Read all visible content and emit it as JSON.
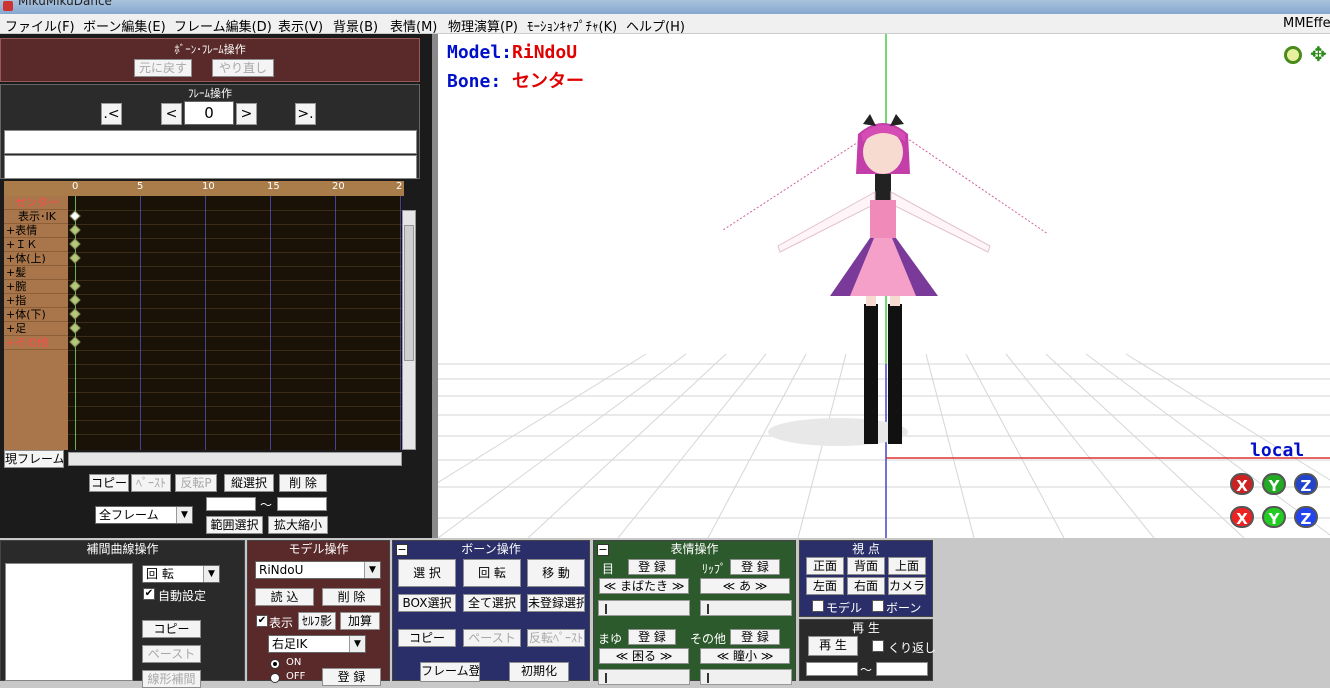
{
  "window": {
    "title": "MikuMikuDance",
    "right_title": "MMEffect"
  },
  "menu": [
    "ファイル(F)",
    "ボーン編集(E)",
    "フレーム編集(D)",
    "表示(V)",
    "背景(B)",
    "表情(M)",
    "物理演算(P)",
    "ﾓｰｼｮﾝｷｬﾌﾟﾁｬ(K)",
    "ヘルプ(H)"
  ],
  "bone_frame_op": {
    "title": "ﾎﾞｰﾝ･ﾌﾚｰﾑ操作",
    "undo": "元に戻す",
    "redo": "やり直し"
  },
  "frame_op": {
    "title": "ﾌﾚｰﾑ操作",
    "prev_key": ".<",
    "prev": "<",
    "frame": "0",
    "next": ">",
    "next_key": ">."
  },
  "timeline": {
    "ticks": [
      "0",
      "5",
      "10",
      "15",
      "20",
      "2"
    ],
    "rows": [
      "センター",
      "表示･IK",
      "+表情",
      "+ＩＫ",
      "+体(上)",
      "+髪",
      "+腕",
      "+指",
      "+体(下)",
      "+足",
      "+その他"
    ]
  },
  "timeline_btns": {
    "current": "現フレーム",
    "copy": "コピー",
    "paste": "ﾍﾟｰｽﾄ",
    "reverse": "反転P",
    "vertical_select": "縦選択",
    "delete": "削 除",
    "all_frames": "全フレーム",
    "range_select": "範囲選択",
    "zoom": "拡大縮小",
    "tilde": "〜"
  },
  "viewport": {
    "model_label": "Model:",
    "model_name": "RiNdoU",
    "bone_label": "Bone:",
    "bone_name": "センター",
    "local": "local",
    "axes": [
      "X",
      "Y",
      "Z"
    ]
  },
  "interp": {
    "title": "補間曲線操作",
    "rotation": "回 転",
    "auto": "自動設定",
    "copy": "コピー",
    "paste": "ペースト",
    "linear": "線形補間"
  },
  "model_op": {
    "title": "モデル操作",
    "model": "RiNdoU",
    "load": "読 込",
    "delete": "削 除",
    "show": "表示",
    "self_shadow": "ｾﾙﾌ影",
    "add": "加算",
    "ik_bone": "右足IK",
    "on": "ON",
    "off": "OFF",
    "register": "登 録"
  },
  "bone_op": {
    "title": "ボーン操作",
    "select": "選 択",
    "rotate": "回 転",
    "move": "移 動",
    "box_select": "BOX選択",
    "select_all": "全て選択",
    "unreg_select": "未登録選択",
    "copy": "コピー",
    "paste": "ペースト",
    "rev_paste": "反転ﾍﾟｰｽﾄ",
    "frame_reg": "フレーム登録",
    "init": "初期化"
  },
  "face_op": {
    "title": "表情操作",
    "eye": "目",
    "lip": "ﾘｯﾌﾟ",
    "brow": "まゆ",
    "other": "その他",
    "register": "登 録",
    "eye_val": "まばたき",
    "lip_val": "あ",
    "brow_val": "困る",
    "other_val": "瞳小"
  },
  "view_op": {
    "title": "視 点",
    "front": "正面",
    "back": "背面",
    "top": "上面",
    "left": "左面",
    "right": "右面",
    "camera": "カメラ",
    "model": "モデル",
    "bone": "ボーン"
  },
  "play": {
    "title": "再 生",
    "play": "再 生",
    "loop": "くり返し",
    "tilde": "〜"
  },
  "colors": {
    "accent": "#0010c8",
    "bone_red": "#e00000",
    "timeline_bg": "#1a1207",
    "label_bg": "#a8764a"
  }
}
